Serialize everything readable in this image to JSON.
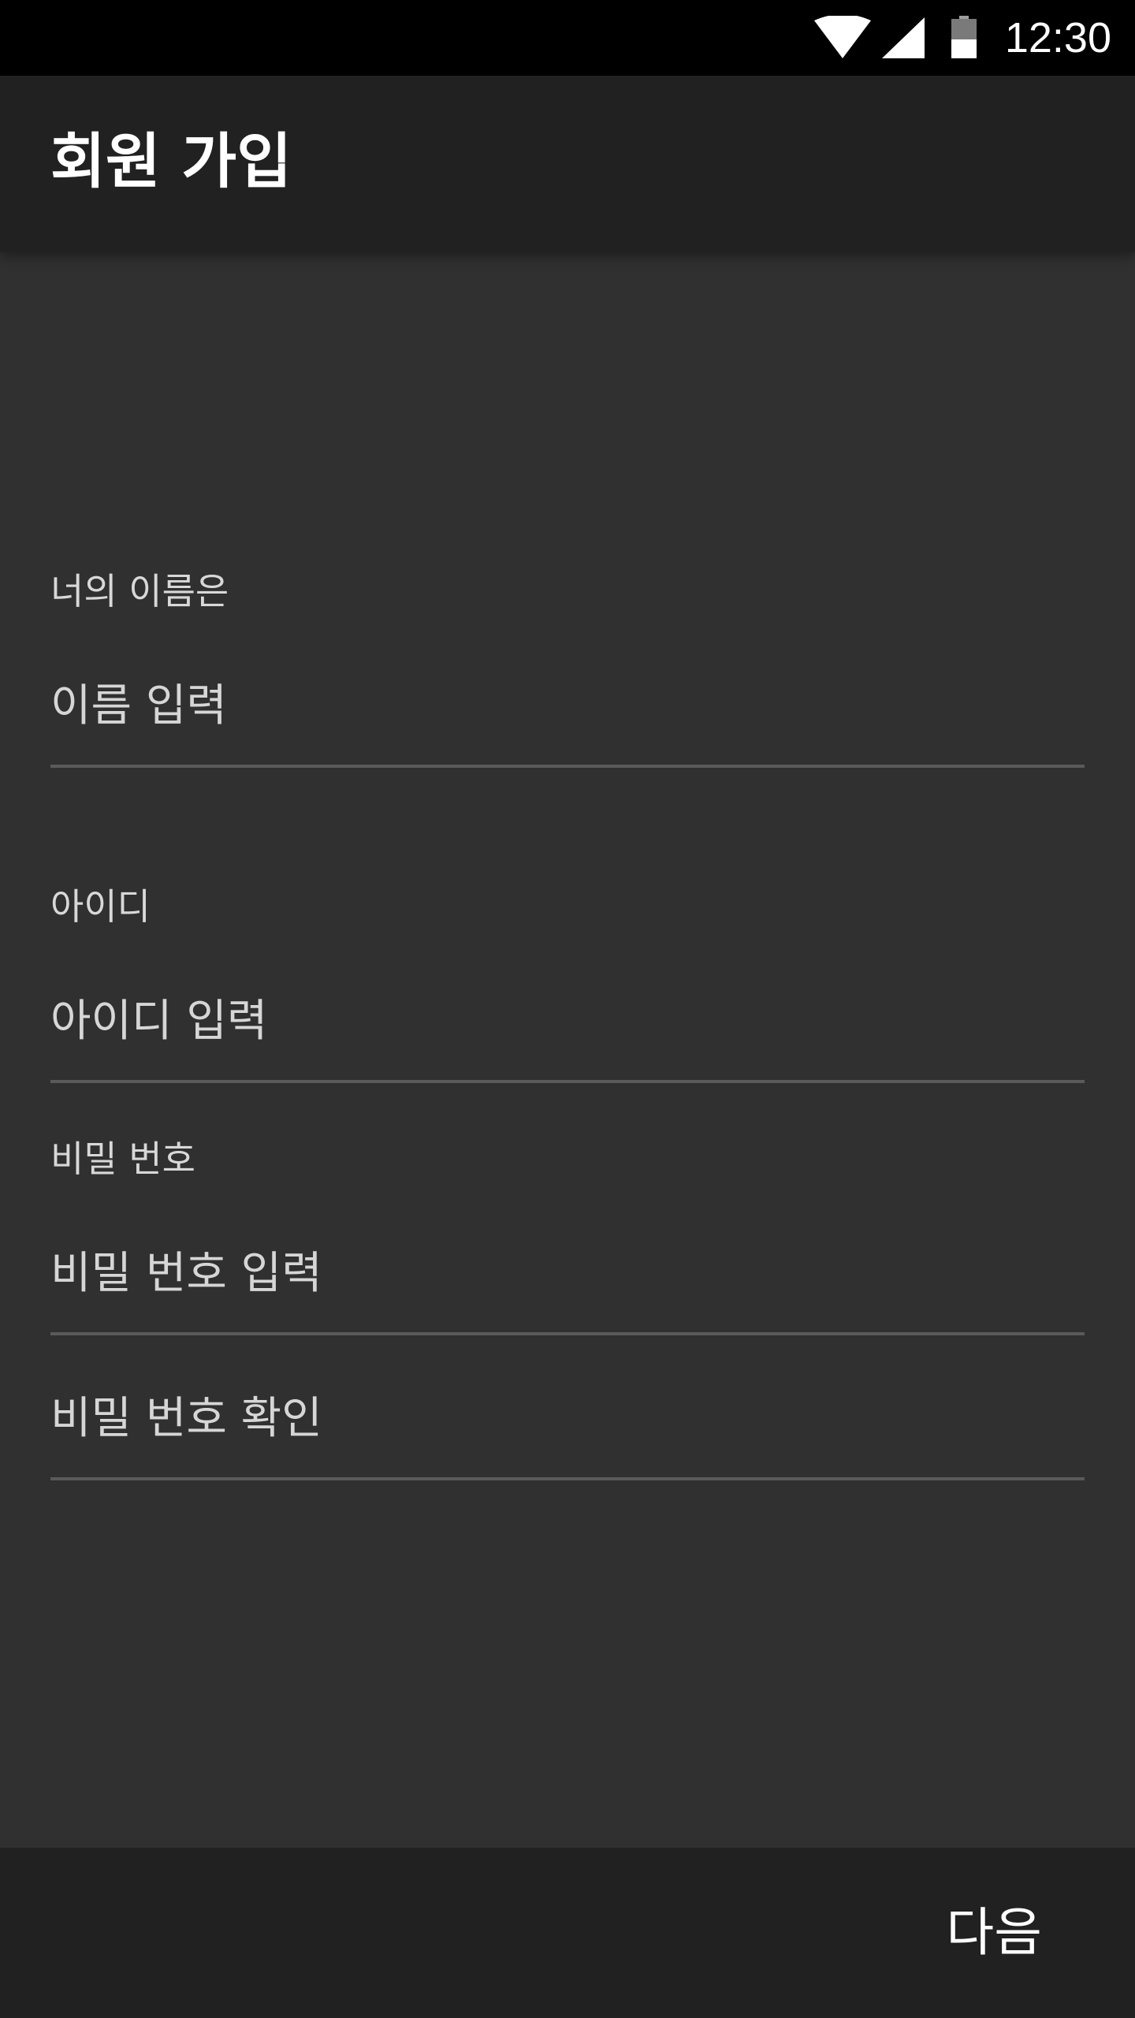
{
  "status_bar": {
    "time": "12:30",
    "icons": [
      "wifi-icon",
      "signal-icon",
      "battery-icon"
    ]
  },
  "app_bar": {
    "title": "회원 가입"
  },
  "form": {
    "name": {
      "label": "너의 이름은",
      "placeholder": "이름 입력",
      "value": ""
    },
    "id": {
      "label": "아이디",
      "placeholder": "아이디 입력",
      "value": ""
    },
    "password": {
      "label": "비밀 번호",
      "placeholder": "비밀 번호 입력",
      "value": ""
    },
    "password_confirm": {
      "placeholder": "비밀 번호 확인",
      "value": ""
    }
  },
  "bottom_bar": {
    "next_label": "다음"
  },
  "colors": {
    "status_bar": "#000000",
    "app_bar": "#212121",
    "background": "#303030",
    "underline": "#5a5a5a",
    "text": "#ffffff"
  }
}
